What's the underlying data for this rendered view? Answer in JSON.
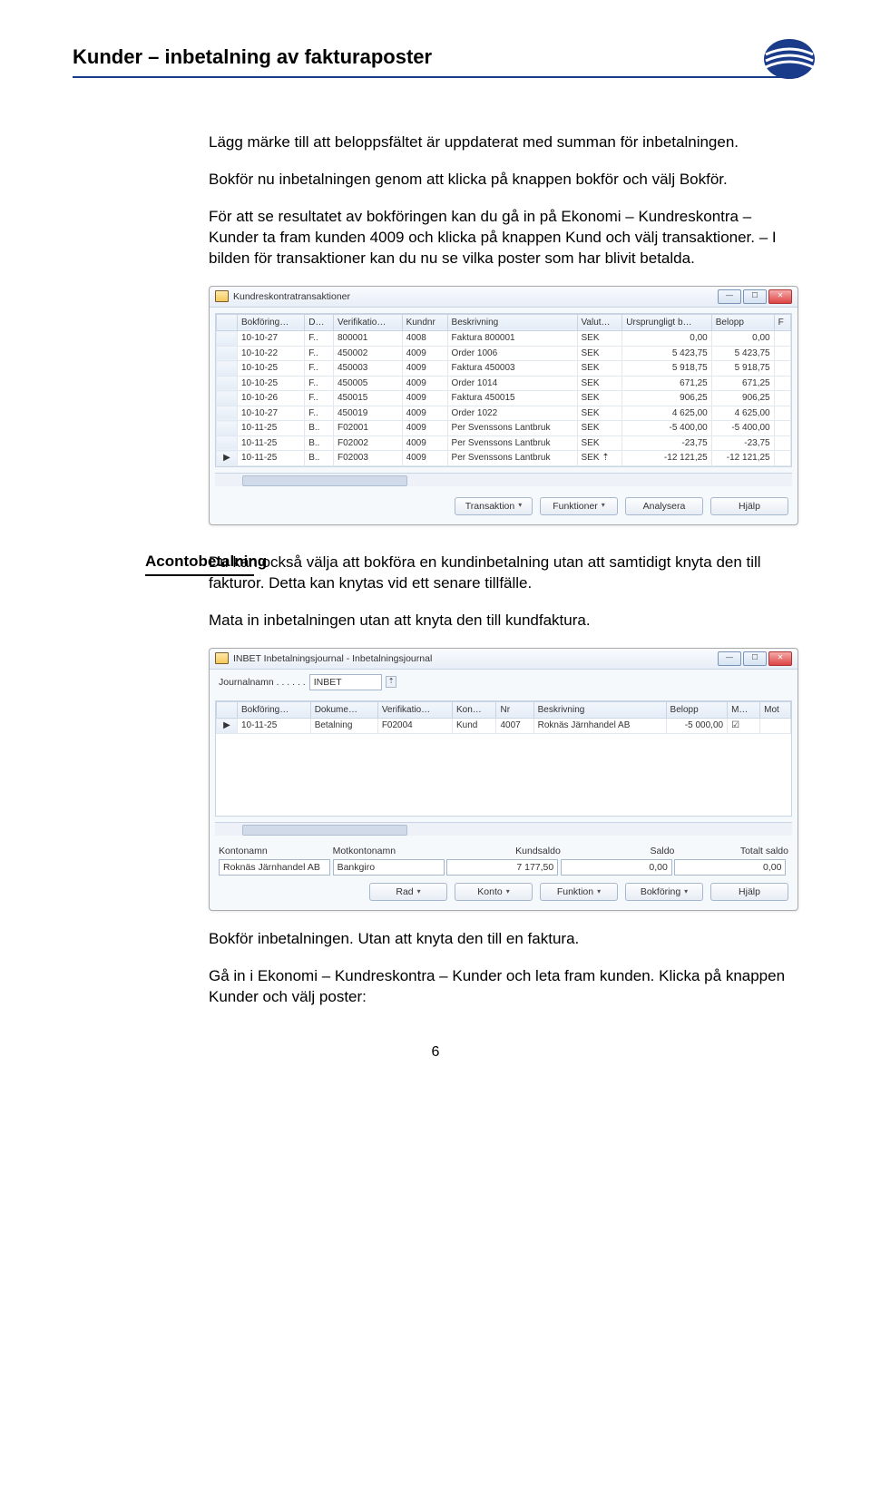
{
  "header": {
    "title": "Kunder – inbetalning av fakturaposter"
  },
  "intro": {
    "p1": "Lägg märke till att beloppsfältet är uppdaterat med summan för inbetalningen.",
    "p2": "Bokför nu inbetalningen genom att klicka på knappen bokför och välj Bokför.",
    "p3": "För att se resultatet av bokföringen kan du gå in på Ekonomi – Kundreskontra – Kunder ta fram kunden 4009 och klicka på knappen Kund och välj transaktioner. – I bilden för transaktioner kan du nu se vilka poster som har blivit betalda."
  },
  "win1": {
    "title": "Kundreskontratransaktioner",
    "columns": [
      "",
      "Bokföring…",
      "D…",
      "Verifikatio…",
      "Kundnr",
      "Beskrivning",
      "Valut…",
      "Ursprungligt b…",
      "Belopp",
      "F"
    ],
    "rows": [
      [
        "",
        "10-10-27",
        "F..",
        "800001",
        "4008",
        "Faktura 800001",
        "SEK",
        "0,00",
        "0,00",
        ""
      ],
      [
        "",
        "10-10-22",
        "F..",
        "450002",
        "4009",
        "Order 1006",
        "SEK",
        "5 423,75",
        "5 423,75",
        ""
      ],
      [
        "",
        "10-10-25",
        "F..",
        "450003",
        "4009",
        "Faktura 450003",
        "SEK",
        "5 918,75",
        "5 918,75",
        ""
      ],
      [
        "",
        "10-10-25",
        "F..",
        "450005",
        "4009",
        "Order 1014",
        "SEK",
        "671,25",
        "671,25",
        ""
      ],
      [
        "",
        "10-10-26",
        "F..",
        "450015",
        "4009",
        "Faktura 450015",
        "SEK",
        "906,25",
        "906,25",
        ""
      ],
      [
        "",
        "10-10-27",
        "F..",
        "450019",
        "4009",
        "Order 1022",
        "SEK",
        "4 625,00",
        "4 625,00",
        ""
      ],
      [
        "",
        "10-11-25",
        "B..",
        "F02001",
        "4009",
        "Per Svenssons Lantbruk",
        "SEK",
        "-5 400,00",
        "-5 400,00",
        ""
      ],
      [
        "",
        "10-11-25",
        "B..",
        "F02002",
        "4009",
        "Per Svenssons Lantbruk",
        "SEK",
        "-23,75",
        "-23,75",
        ""
      ],
      [
        "▶",
        "10-11-25",
        "B..",
        "F02003",
        "4009",
        "Per Svenssons Lantbruk",
        "SEK ⇡",
        "-12 121,25",
        "-12 121,25",
        ""
      ]
    ],
    "buttons": {
      "transaction": "Transaktion",
      "functions": "Funktioner",
      "analyze": "Analysera",
      "help": "Hjälp"
    }
  },
  "aconto": {
    "label": "Acontobetalning",
    "p1": "Du kan också välja att bokföra en kundinbetalning utan att samtidigt knyta den till fakturor. Detta kan knytas vid ett senare tillfälle.",
    "p2": "Mata in inbetalningen utan att knyta den till kundfaktura."
  },
  "win2": {
    "title": "INBET Inbetalningsjournal - Inbetalningsjournal",
    "journal_label": "Journalnamn . . . . . .",
    "journal_value": "INBET",
    "columns": [
      "",
      "Bokföring…",
      "Dokume…",
      "Verifikatio…",
      "Kon…",
      "Nr",
      "Beskrivning",
      "Belopp",
      "M…",
      "Mot"
    ],
    "rows": [
      [
        "▶",
        "10-11-25",
        "Betalning",
        "F02004",
        "Kund",
        "4007",
        "Roknäs Järnhandel AB",
        "-5 000,00",
        "☑",
        ""
      ]
    ],
    "summary_labels": {
      "kontonamn": "Kontonamn",
      "motkontonamn": "Motkontonamn",
      "kundsaldo": "Kundsaldo",
      "saldo": "Saldo",
      "totalt": "Totalt saldo"
    },
    "summary_values": {
      "kontonamn": "Roknäs Järnhandel AB",
      "motkontonamn": "Bankgiro",
      "kundsaldo": "7 177,50",
      "saldo": "0,00",
      "totalt": "0,00"
    },
    "buttons": {
      "rad": "Rad",
      "konto": "Konto",
      "funktion": "Funktion",
      "bokforing": "Bokföring",
      "help": "Hjälp"
    }
  },
  "outro": {
    "p1": "Bokför inbetalningen. Utan att knyta den till en faktura.",
    "p2": "Gå in i Ekonomi – Kundreskontra – Kunder och leta fram kunden. Klicka på knappen Kunder och välj poster:"
  },
  "page_number": "6"
}
